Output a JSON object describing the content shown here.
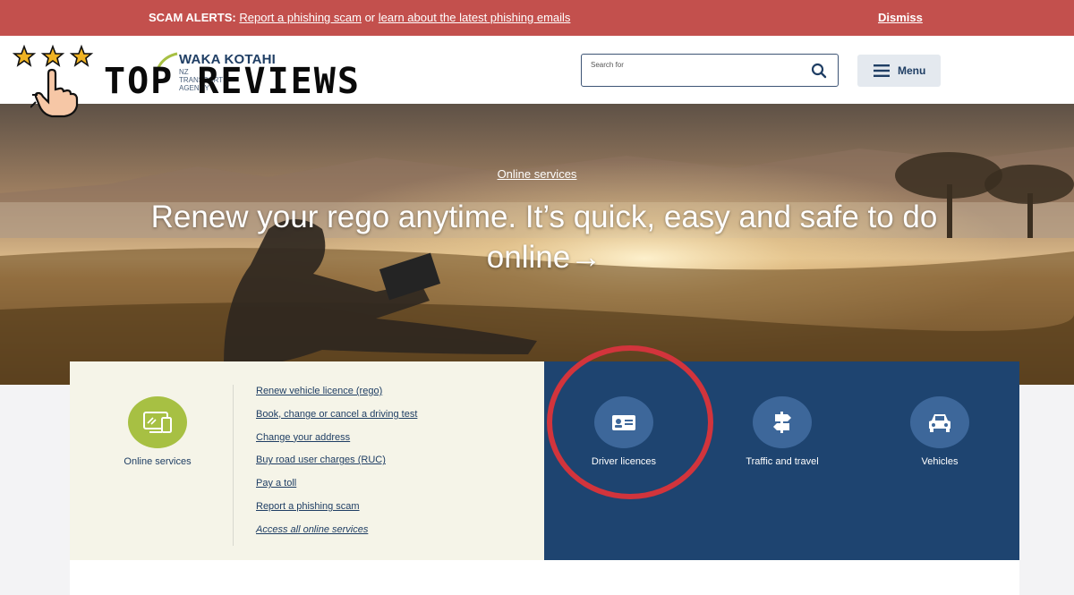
{
  "alert": {
    "prefix": "SCAM ALERTS:",
    "link1": "Report a phishing scam",
    "connector": "or",
    "link2": "learn about the latest phishing emails",
    "dismiss": "Dismiss"
  },
  "header": {
    "logo_brand": "WAKA KOTAHI",
    "logo_sub": "NZ TRANSPORT AGENCY",
    "search_label": "Search for",
    "menu_label": "Menu"
  },
  "overlay": {
    "title": "TOP REVIEWS"
  },
  "hero": {
    "eyebrow": "Online services",
    "title": "Renew your rego anytime. It’s quick, easy and safe to do online→"
  },
  "online_services": {
    "label": "Online services",
    "links": [
      "Renew vehicle licence (rego)",
      "Book, change or cancel a driving test",
      "Change your address",
      "Buy road user charges (RUC)",
      "Pay a toll",
      "Report a phishing scam",
      "Access all online services"
    ]
  },
  "categories": [
    {
      "label": "Driver licences",
      "icon": "id-card-icon"
    },
    {
      "label": "Traffic and travel",
      "icon": "signpost-icon"
    },
    {
      "label": "Vehicles",
      "icon": "car-icon"
    }
  ],
  "colors": {
    "alert": "#c3504d",
    "navy": "#1e4470",
    "green": "#a7c043",
    "cream": "#f5f4e8",
    "highlight_ring": "#d2343c"
  }
}
